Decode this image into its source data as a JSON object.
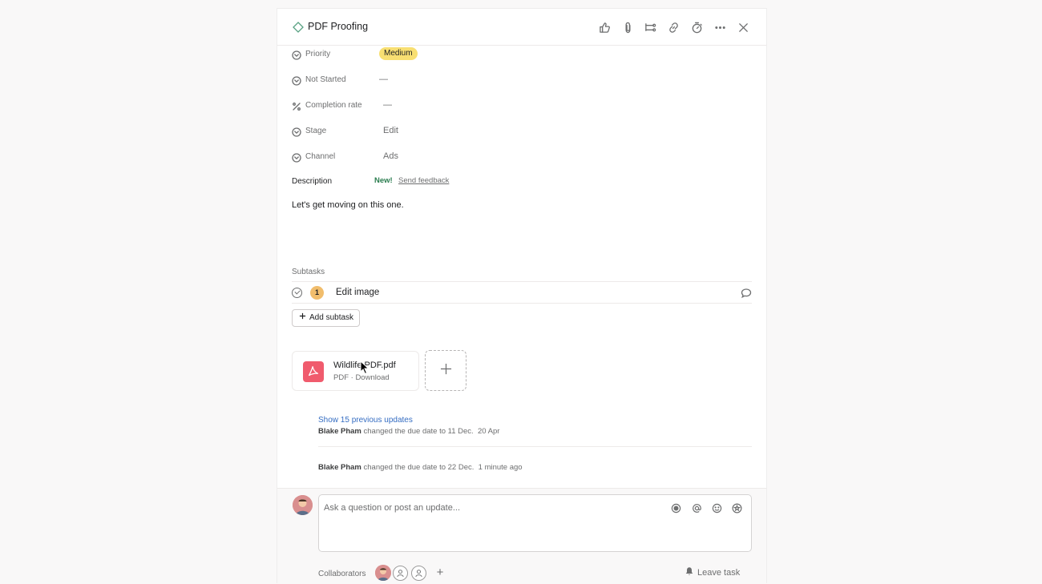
{
  "task": {
    "title": "PDF Proofing"
  },
  "header_actions": [
    "like-icon",
    "attachment-icon",
    "subtask-icon",
    "link-icon",
    "timer-icon",
    "more-icon",
    "close-icon"
  ],
  "fields": {
    "priority": {
      "label": "Priority",
      "value": "Medium",
      "badge_color": "#f8df72"
    },
    "status": {
      "label": "Not Started",
      "value": "—"
    },
    "completion": {
      "label": "Completion rate",
      "value": "—"
    },
    "stage": {
      "label": "Stage",
      "value": "Edit"
    },
    "channel": {
      "label": "Channel",
      "value": "Ads"
    }
  },
  "description": {
    "label": "Description",
    "new_tag": "New!",
    "feedback_link": "Send feedback",
    "text": "Let's get moving on this one."
  },
  "subtasks": {
    "label": "Subtasks",
    "items": [
      {
        "number": "1",
        "name": "Edit image"
      }
    ],
    "add_label": "Add subtask"
  },
  "attachment": {
    "name": "Wildlife PDF.pdf",
    "meta": "PDF · Download",
    "icon_color": "#f05b6d"
  },
  "activity": {
    "show_previous": "Show 15 previous updates",
    "entries": [
      {
        "author": "Blake Pham",
        "text": "changed the due date to 11 Dec.",
        "time": "20 Apr"
      },
      {
        "author": "Blake Pham",
        "text": "changed the due date to 22 Dec.",
        "time": "1 minute ago"
      }
    ]
  },
  "composer": {
    "placeholder": "Ask a question or post an update..."
  },
  "collaborators": {
    "label": "Collaborators",
    "leave_label": "Leave task"
  },
  "colors": {
    "accent_link": "#356dc2",
    "new_tag": "#2a7d4f",
    "subtask_badge": "#f1bd6c"
  }
}
